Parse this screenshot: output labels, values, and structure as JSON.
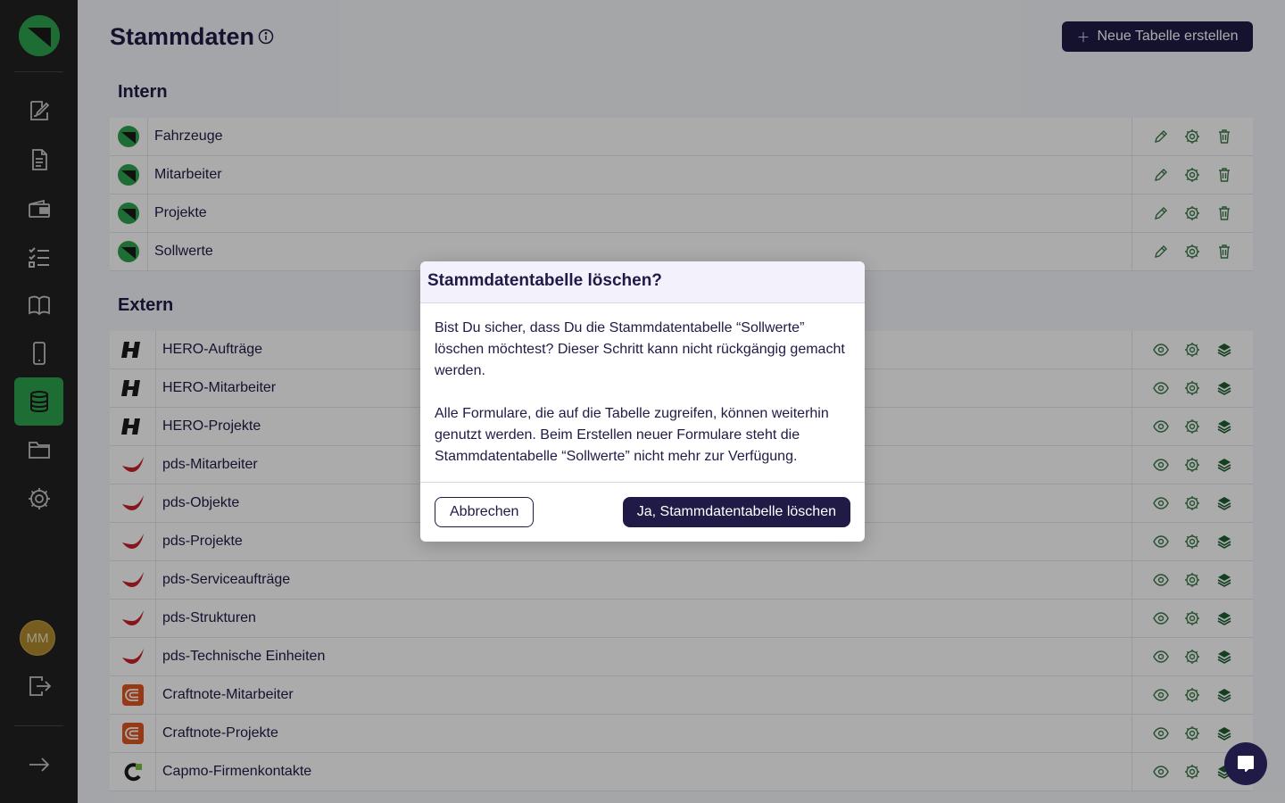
{
  "page": {
    "title": "Stammdaten",
    "new_table_label": "Neue Tabelle erstellen"
  },
  "sidebar": {
    "items": [
      {
        "name": "edit-form-icon"
      },
      {
        "name": "document-icon"
      },
      {
        "name": "wallet-icon"
      },
      {
        "name": "checklist-icon"
      },
      {
        "name": "book-icon"
      },
      {
        "name": "phone-icon"
      },
      {
        "name": "database-icon",
        "active": true
      },
      {
        "name": "folder-icon"
      },
      {
        "name": "gear-icon"
      }
    ],
    "avatar_initials": "MM"
  },
  "sections": {
    "intern": {
      "title": "Intern",
      "rows": [
        "Fahrzeuge",
        "Mitarbeiter",
        "Projekte",
        "Sollwerte"
      ]
    },
    "extern": {
      "title": "Extern",
      "rows": [
        {
          "label": "HERO-Aufträge",
          "source": "hero"
        },
        {
          "label": "HERO-Mitarbeiter",
          "source": "hero"
        },
        {
          "label": "HERO-Projekte",
          "source": "hero"
        },
        {
          "label": "pds-Mitarbeiter",
          "source": "pds"
        },
        {
          "label": "pds-Objekte",
          "source": "pds"
        },
        {
          "label": "pds-Projekte",
          "source": "pds"
        },
        {
          "label": "pds-Serviceaufträge",
          "source": "pds"
        },
        {
          "label": "pds-Strukturen",
          "source": "pds"
        },
        {
          "label": "pds-Technische Einheiten",
          "source": "pds"
        },
        {
          "label": "Craftnote-Mitarbeiter",
          "source": "craftnote"
        },
        {
          "label": "Craftnote-Projekte",
          "source": "craftnote"
        },
        {
          "label": "Capmo-Firmenkontakte",
          "source": "capmo"
        }
      ]
    }
  },
  "modal": {
    "title": "Stammdatentabelle löschen?",
    "paragraph1": "Bist Du sicher, dass Du die Stammdatentabelle “Sollwerte” löschen möchtest? Dieser Schritt kann nicht rückgängig gemacht werden.",
    "paragraph2": "Alle Formulare, die auf die Tabelle zugreifen, können weiterhin genutzt werden. Beim Erstellen neuer Formulare steht die Stammdatentabelle “Sollwerte” nicht mehr zur Verfügung.",
    "cancel_label": "Abbrechen",
    "confirm_label": "Ja, Stammdatentabelle löschen"
  },
  "colors": {
    "brand_green": "#2ea34e",
    "primary_navy": "#1f1b46",
    "sidebar_bg": "#222222"
  }
}
